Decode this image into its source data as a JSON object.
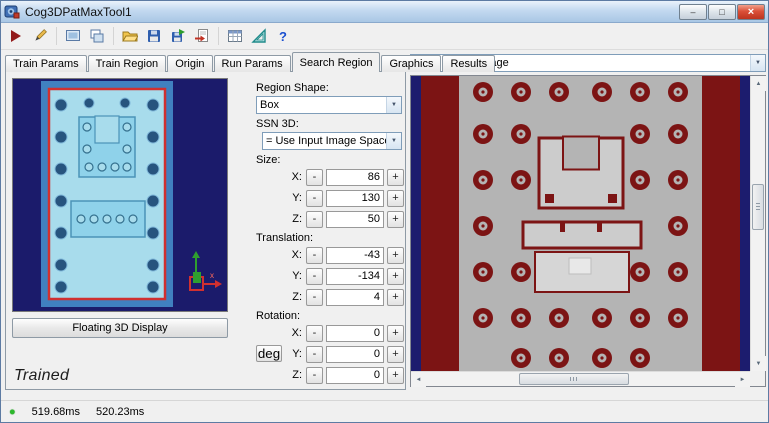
{
  "window": {
    "title": "Cog3DPatMaxTool1",
    "minimize_glyph": "–",
    "maximize_glyph": "□",
    "close_glyph": "×"
  },
  "toolbar": {
    "help_glyph": "?",
    "icons": [
      "run-tool-icon",
      "edit-graphics-icon",
      "image-display-icon",
      "windows-icon",
      "open-file-icon",
      "save-icon",
      "save-image-icon",
      "import-image-icon",
      "results-grid-icon",
      "geometry-icon",
      "help-icon"
    ]
  },
  "tabs": [
    "Train Params",
    "Train Region",
    "Origin",
    "Run Params",
    "Search Region",
    "Graphics",
    "Results"
  ],
  "active_tab": "Search Region",
  "left_panel": {
    "floating_button_label": "Floating 3D Display",
    "trained_label": "Trained"
  },
  "search_region": {
    "region_shape_label": "Region Shape:",
    "region_shape_value": "Box",
    "ssn_label": "SSN 3D:",
    "ssn_value": "= Use Input Image Space",
    "size_label": "Size:",
    "translation_label": "Translation:",
    "rotation_label": "Rotation:",
    "deg_button_label": "deg",
    "x_label": "X:",
    "y_label": "Y:",
    "z_label": "Z:",
    "minus_label": "-",
    "plus_label": "+",
    "size": {
      "x": "86",
      "y": "130",
      "z": "50"
    },
    "translation": {
      "x": "-43",
      "y": "-134",
      "z": "4"
    },
    "rotation": {
      "x": "0",
      "y": "0",
      "z": "0"
    }
  },
  "image_panel": {
    "selected_image": "Current.InputImage",
    "dropdown_arrow": "▼"
  },
  "scrollbars": {
    "up": "▲",
    "down": "▼",
    "left": "◄",
    "right": "►"
  },
  "status_bar": {
    "status_dot": "●",
    "time_1": "519.68ms",
    "time_2": "520.23ms"
  },
  "colors": {
    "viewport_background": "#1b1b6b",
    "plate_blue": "#4080c0",
    "region_fill_cyan": "#a8dcec",
    "search_box_red": "#d03030",
    "image_maroon": "#7c1414",
    "image_gray": "#b4b4b4",
    "status_green": "#2db82d",
    "titlebar_blue": "#bcd5ee"
  }
}
